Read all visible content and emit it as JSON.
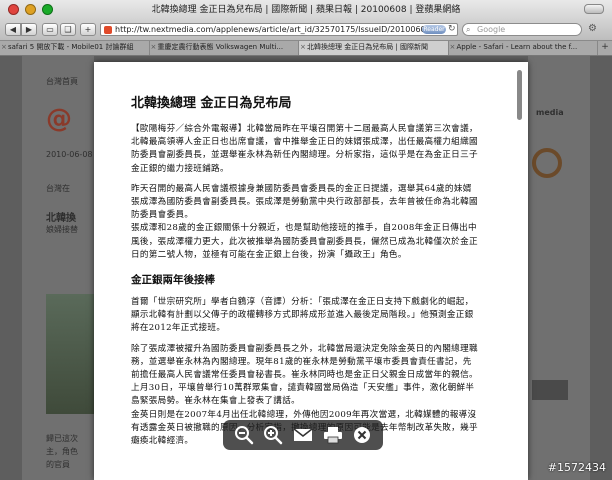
{
  "window": {
    "title": "北韓換總理 金正日為兒布局 | 國際新聞 | 蘋果日報 | 20100608 | 登蘋果網絡"
  },
  "toolbar": {
    "url": "http://tw.nextmedia.com/applenews/article/art_id/32570175/IssueID/20100608",
    "reader_label": "Reader",
    "search_placeholder": "Google"
  },
  "tabs": [
    {
      "label": "safari 5 開放下載 - Mobile01 討論群組",
      "active": false
    },
    {
      "label": "重慶定農行動表態 Volkswagen Multi...",
      "active": false
    },
    {
      "label": "北韓換總理 金正日為兒布局 | 國際新聞",
      "active": true
    },
    {
      "label": "Apple - Safari - Learn about the f...",
      "active": false
    }
  ],
  "background_page": {
    "date_text": "台灣首頁",
    "left_snippets": [
      "頭條",
      "台灣在",
      "2010-06-08",
      "台灣在",
      "北韓換",
      "娘婦接替"
    ],
    "right_snippets": [
      "media"
    ],
    "left_bottom": [
      "歸已這次",
      "主，角色",
      "的官員"
    ]
  },
  "article": {
    "headline": "北韓換總理 金正日為兒布局",
    "paragraphs": [
      "【歐陽梅芬／綜合外電報導】北韓當局昨在平壤召開第十二屆最高人民會議第三次會議，北韓最高領導人金正日也出席會議，會中推舉金正日的妹婿張成澤，出任最高權力組織國防委員會副委員長，並選舉崔永林為新任內閣總理。分析家指，這似乎是在為金正日三子金正銀的繼力接班鋪路。",
      "昨天召開的最高人民會議根據身兼國防委員會委員長的金正日提議，選舉其64歲的妹婿張成澤為國防委員會副委員長。張成澤是勞動黨中央行政部部長，去年曾被任命為北韓國防委員會委員。",
      "張成澤和28歲的金正銀關係十分親近，也是幫助他接班的推手，自2008年金正日傳出中風後，張成澤權力更大，此次被推舉為國防委員會副委員長，儼然已成為北韓僅次於金正日的第二號人物，並極有可能在金正銀上台後，扮演「攝政王」角色。"
    ],
    "subhead": "金正銀兩年後接棒",
    "paragraphs2": [
      "首爾「世宗研究所」學者白鶴淳（音譯）分析：「張成澤在金正日支持下戲劇化的崛起，顯示北韓有計劃以父傳子的政權轉移方式即將成形並進入最後定局階段。」他預測金正銀將在2012年正式接班。",
      "除了張成澤被擢升為國防委員會副委員長之外，北韓當局還決定免除金英日的內閣總理職務，並選舉崔永林為內閣總理。現年81歲的崔永林是勞動黨平壤市委員會責任書記，先前擔任最高人民會議常任委員會秘書長。崔永林同時也是金正日父親金日成當年的親信。",
      "上月30日，平壤曾舉行10萬群眾集會，譴責韓國當局偽造「天安艦」事件，激化朝鮮半島緊張局勢。崔永林在集會上發表了講話。",
      "金英日則是在2007年4月出任北韓總理，外傳他因2009年再次當選，北韓媒體的報導沒有透露金英日被撤職的原因。分析家指，撤換總理的原因可能是去年幣制改革失敗，幾乎癱瘓北韓經濟。"
    ]
  },
  "hud": {
    "buttons": [
      "zoom-out",
      "zoom-in",
      "mail",
      "print",
      "close"
    ]
  },
  "watermark": "#1572434"
}
